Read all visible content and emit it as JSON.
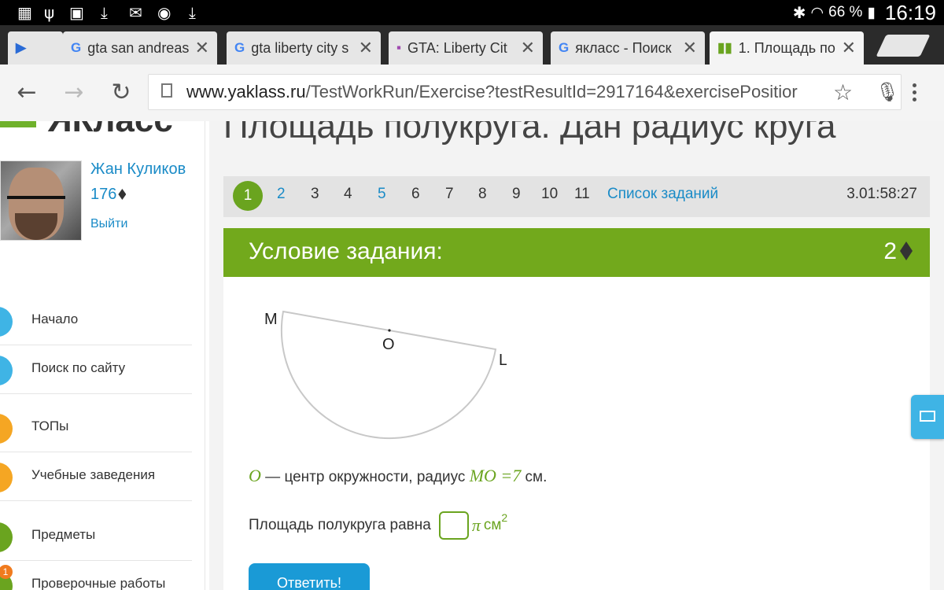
{
  "status_bar": {
    "battery": "66 %",
    "time": "16:19"
  },
  "tabs": [
    {
      "title": "gta san andreas",
      "icon": "G"
    },
    {
      "title": "gta liberty city s",
      "icon": "G"
    },
    {
      "title": "GTA: Liberty Cit",
      "icon": "▪"
    },
    {
      "title": "якласс - Поиск",
      "icon": "G"
    },
    {
      "title": "1. Площадь по",
      "icon": "▮▮"
    }
  ],
  "toolbar": {
    "url_host": "www.yaklass.ru",
    "url_path": "/TestWorkRun/Exercise?testResultId=2917164&exercisePositior"
  },
  "sidebar": {
    "logo": "ЯКласс",
    "user_name": "Жан Куликов",
    "user_score": "176",
    "logout": "Выйти",
    "items": [
      {
        "label": "Начало",
        "color": "#3fb4e5"
      },
      {
        "label": "Поиск по сайту",
        "color": "#3fb4e5"
      },
      {
        "label": "ТОПы",
        "color": "#f5a623"
      },
      {
        "label": "Учебные заведения",
        "color": "#f5a623"
      },
      {
        "label": "Предметы",
        "color": "#6aa41f"
      },
      {
        "label": "Проверочные работы",
        "color": "#6aa41f",
        "badge": "1"
      }
    ]
  },
  "main": {
    "title": "Площадь полукруга. Дан радиус круга",
    "pager": {
      "items": [
        "1",
        "2",
        "3",
        "4",
        "5",
        "6",
        "7",
        "8",
        "9",
        "10",
        "11"
      ],
      "current": "1",
      "links": [
        "2",
        "5"
      ],
      "tasks_link": "Список заданий",
      "timer": "3.01:58:27"
    },
    "condition_header": "Условие задания:",
    "points": "2",
    "figure_labels": {
      "m": "M",
      "o": "O",
      "l": "L"
    },
    "text": {
      "o_symbol": "O",
      "center_text": " — центр окружности, радиус ",
      "mo_formula": "MO =7",
      "unit": " см."
    },
    "answer": {
      "prefix": "Площадь полукруга равна",
      "pi": "π",
      "unit": "см",
      "exponent": "2"
    },
    "submit": "Ответить!"
  },
  "colors": {
    "accent_green": "#72a91c",
    "link_blue": "#1a8bc7",
    "button_blue": "#1a9ad6"
  }
}
